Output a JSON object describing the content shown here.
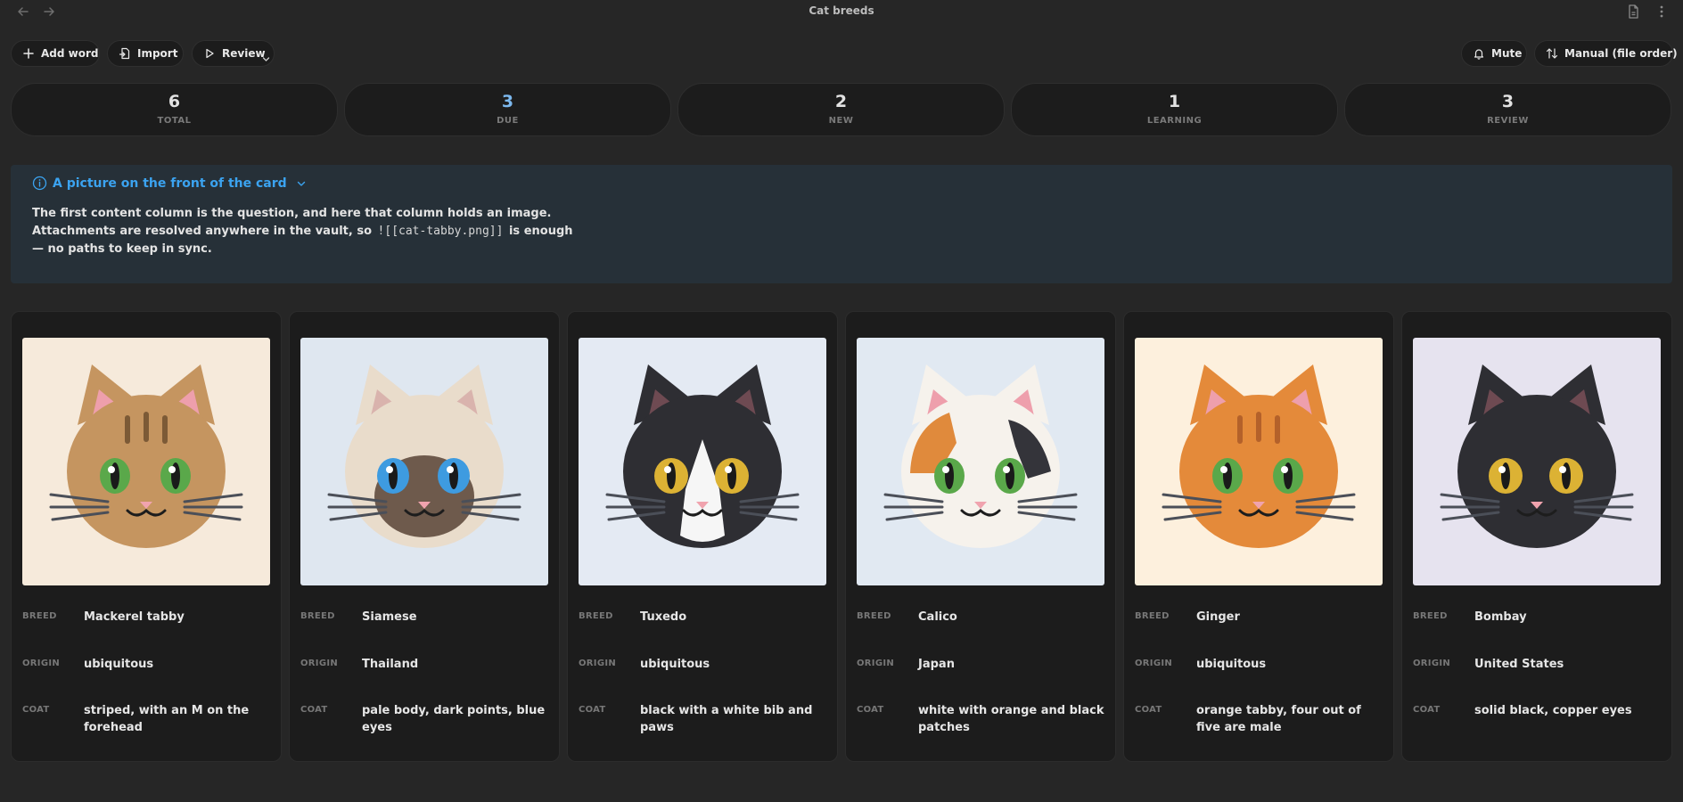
{
  "window": {
    "title": "Cat breeds",
    "icons": [
      "arrow-left-icon",
      "arrow-right-icon",
      "document-icon",
      "more-vertical-icon"
    ]
  },
  "toolbar": {
    "add_word": "Add word",
    "import": "Import",
    "review": "Review",
    "mute": "Mute",
    "sort": "Manual (file order)"
  },
  "stats": [
    {
      "value": "6",
      "label": "TOTAL"
    },
    {
      "value": "3",
      "label": "DUE"
    },
    {
      "value": "2",
      "label": "NEW"
    },
    {
      "value": "1",
      "label": "LEARNING"
    },
    {
      "value": "3",
      "label": "REVIEW"
    }
  ],
  "colors": {
    "accent": "#3ba3f0",
    "due": "#7cb8ee",
    "background": "#262626",
    "card": "#1c1c1c",
    "callout": "#263038"
  },
  "callout": {
    "title": "A picture on the front of the card",
    "line1": "The first content column is the question, and here that column holds an image.",
    "line2_pre": "Attachments are resolved anywhere in the vault, so",
    "code": "![[cat-tabby.png]]",
    "line2_post": "is enough",
    "line3": "— no paths to keep in sync."
  },
  "field_labels": {
    "breed": "BREED",
    "origin": "ORIGIN",
    "coat": "COAT"
  },
  "cards": [
    {
      "breed": "Mackerel tabby",
      "origin": "ubiquitous",
      "coat": "striped, with an M on the forehead"
    },
    {
      "breed": "Siamese",
      "origin": "Thailand",
      "coat": "pale body, dark points, blue eyes"
    },
    {
      "breed": "Tuxedo",
      "origin": "ubiquitous",
      "coat": "black with a white bib and paws"
    },
    {
      "breed": "Calico",
      "origin": "Japan",
      "coat": "white with orange and black patches"
    },
    {
      "breed": "Ginger",
      "origin": "ubiquitous",
      "coat": "orange tabby, four out of five are male"
    },
    {
      "breed": "Bombay",
      "origin": "United States",
      "coat": "solid black, copper eyes"
    }
  ]
}
